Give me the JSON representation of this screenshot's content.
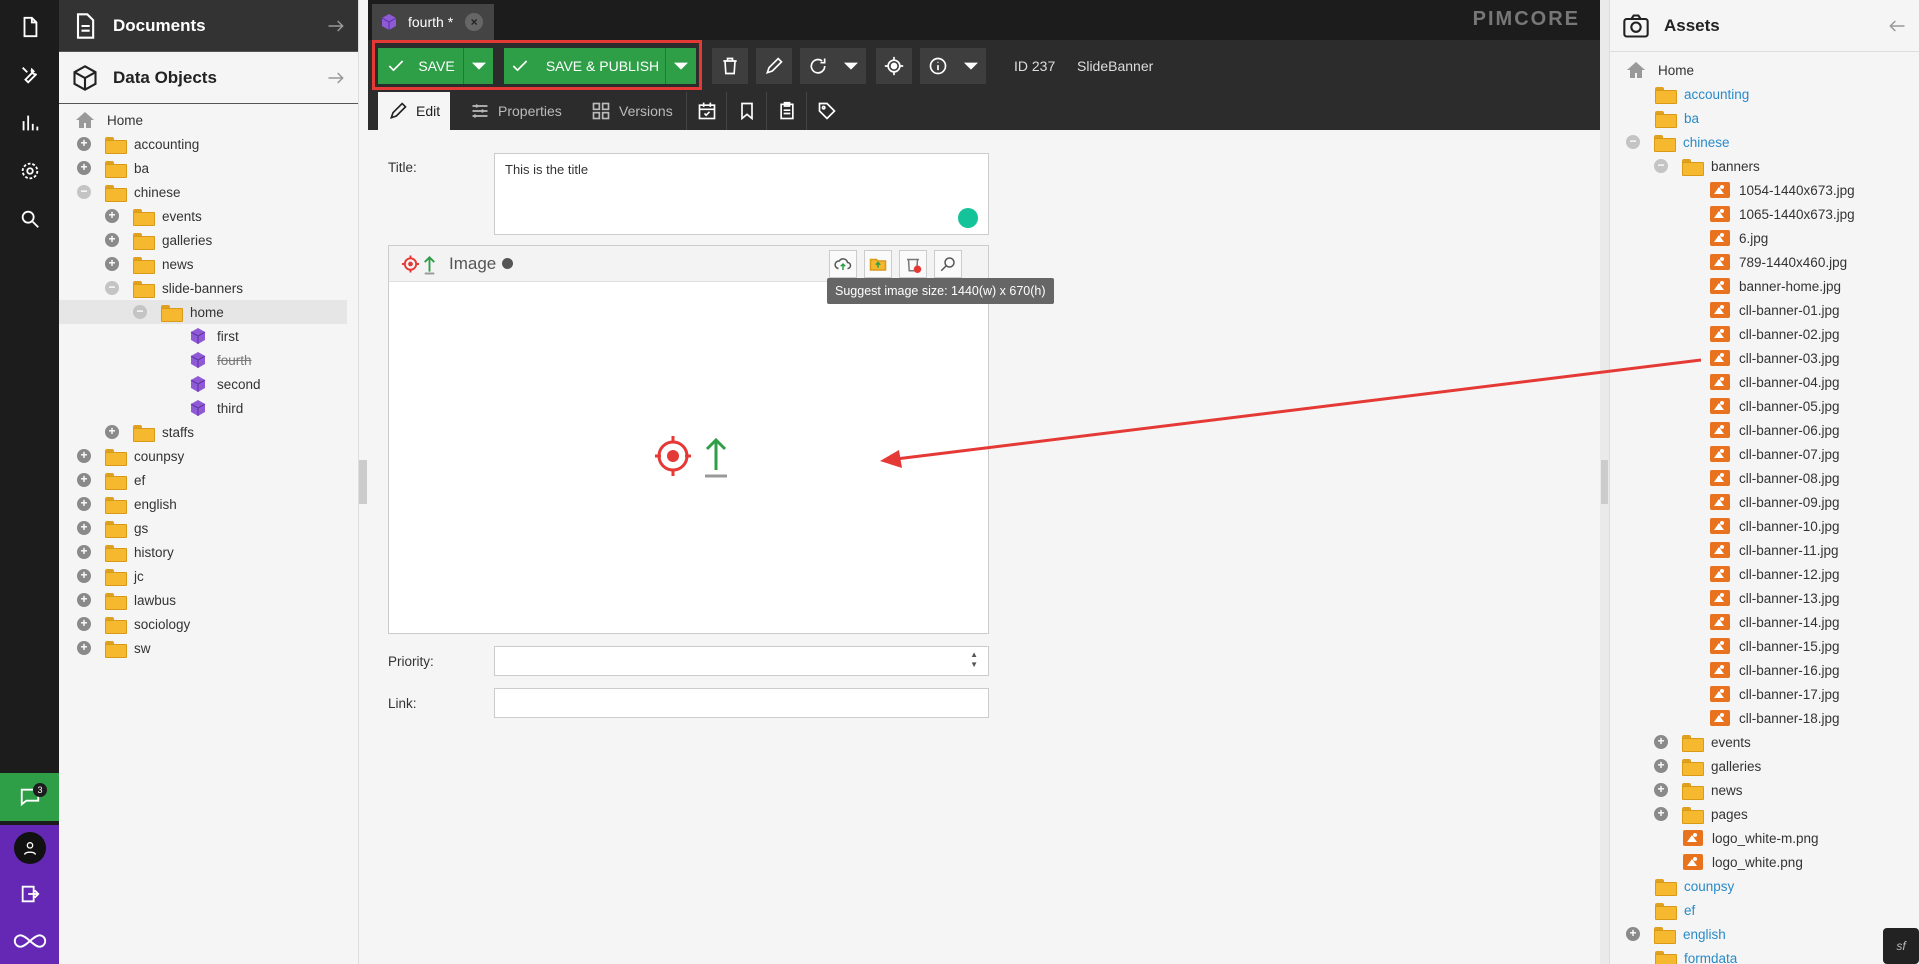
{
  "left_panel": {
    "documents_title": "Documents",
    "data_objects_title": "Data Objects",
    "tree": {
      "home": "Home",
      "accounting": "accounting",
      "ba": "ba",
      "chinese": "chinese",
      "events": "events",
      "galleries": "galleries",
      "news": "news",
      "slide_banners": "slide-banners",
      "home_folder": "home",
      "first": "first",
      "fourth": "fourth",
      "second": "second",
      "third": "third",
      "staffs": "staffs",
      "counpsy": "counpsy",
      "ef": "ef",
      "english": "english",
      "gs": "gs",
      "history": "history",
      "jc": "jc",
      "lawbus": "lawbus",
      "sociology": "sociology",
      "sw": "sw"
    }
  },
  "sidebar": {
    "notification_count": "3"
  },
  "tab": {
    "label": "fourth *"
  },
  "brand": "PIMCORE",
  "toolbar": {
    "save_label": "SAVE",
    "save_publish_label": "SAVE & PUBLISH",
    "id_label": "ID 237",
    "class_label": "SlideBanner"
  },
  "subtabs": {
    "edit": "Edit",
    "properties": "Properties",
    "versions": "Versions"
  },
  "form": {
    "title_label": "Title:",
    "title_value": "This is the title",
    "image_label": "Image",
    "tooltip": "Suggest image size: 1440(w) x 670(h)",
    "priority_label": "Priority:",
    "link_label": "Link:"
  },
  "assets": {
    "title": "Assets",
    "items": [
      "Home",
      "accounting",
      "ba",
      "chinese",
      "banners",
      "1054-1440x673.jpg",
      "1065-1440x673.jpg",
      "6.jpg",
      "789-1440x460.jpg",
      "banner-home.jpg",
      "cll-banner-01.jpg",
      "cll-banner-02.jpg",
      "cll-banner-03.jpg",
      "cll-banner-04.jpg",
      "cll-banner-05.jpg",
      "cll-banner-06.jpg",
      "cll-banner-07.jpg",
      "cll-banner-08.jpg",
      "cll-banner-09.jpg",
      "cll-banner-10.jpg",
      "cll-banner-11.jpg",
      "cll-banner-12.jpg",
      "cll-banner-13.jpg",
      "cll-banner-14.jpg",
      "cll-banner-15.jpg",
      "cll-banner-16.jpg",
      "cll-banner-17.jpg",
      "cll-banner-18.jpg",
      "events",
      "galleries",
      "news",
      "pages",
      "logo_white-m.png",
      "logo_white.png",
      "counpsy",
      "ef",
      "english",
      "formdata"
    ]
  },
  "colors": {
    "save_green": "#2e9e47",
    "highlight_red": "#e53935",
    "asset_link_blue": "#2a8ac7",
    "purple": "#6428b4"
  }
}
